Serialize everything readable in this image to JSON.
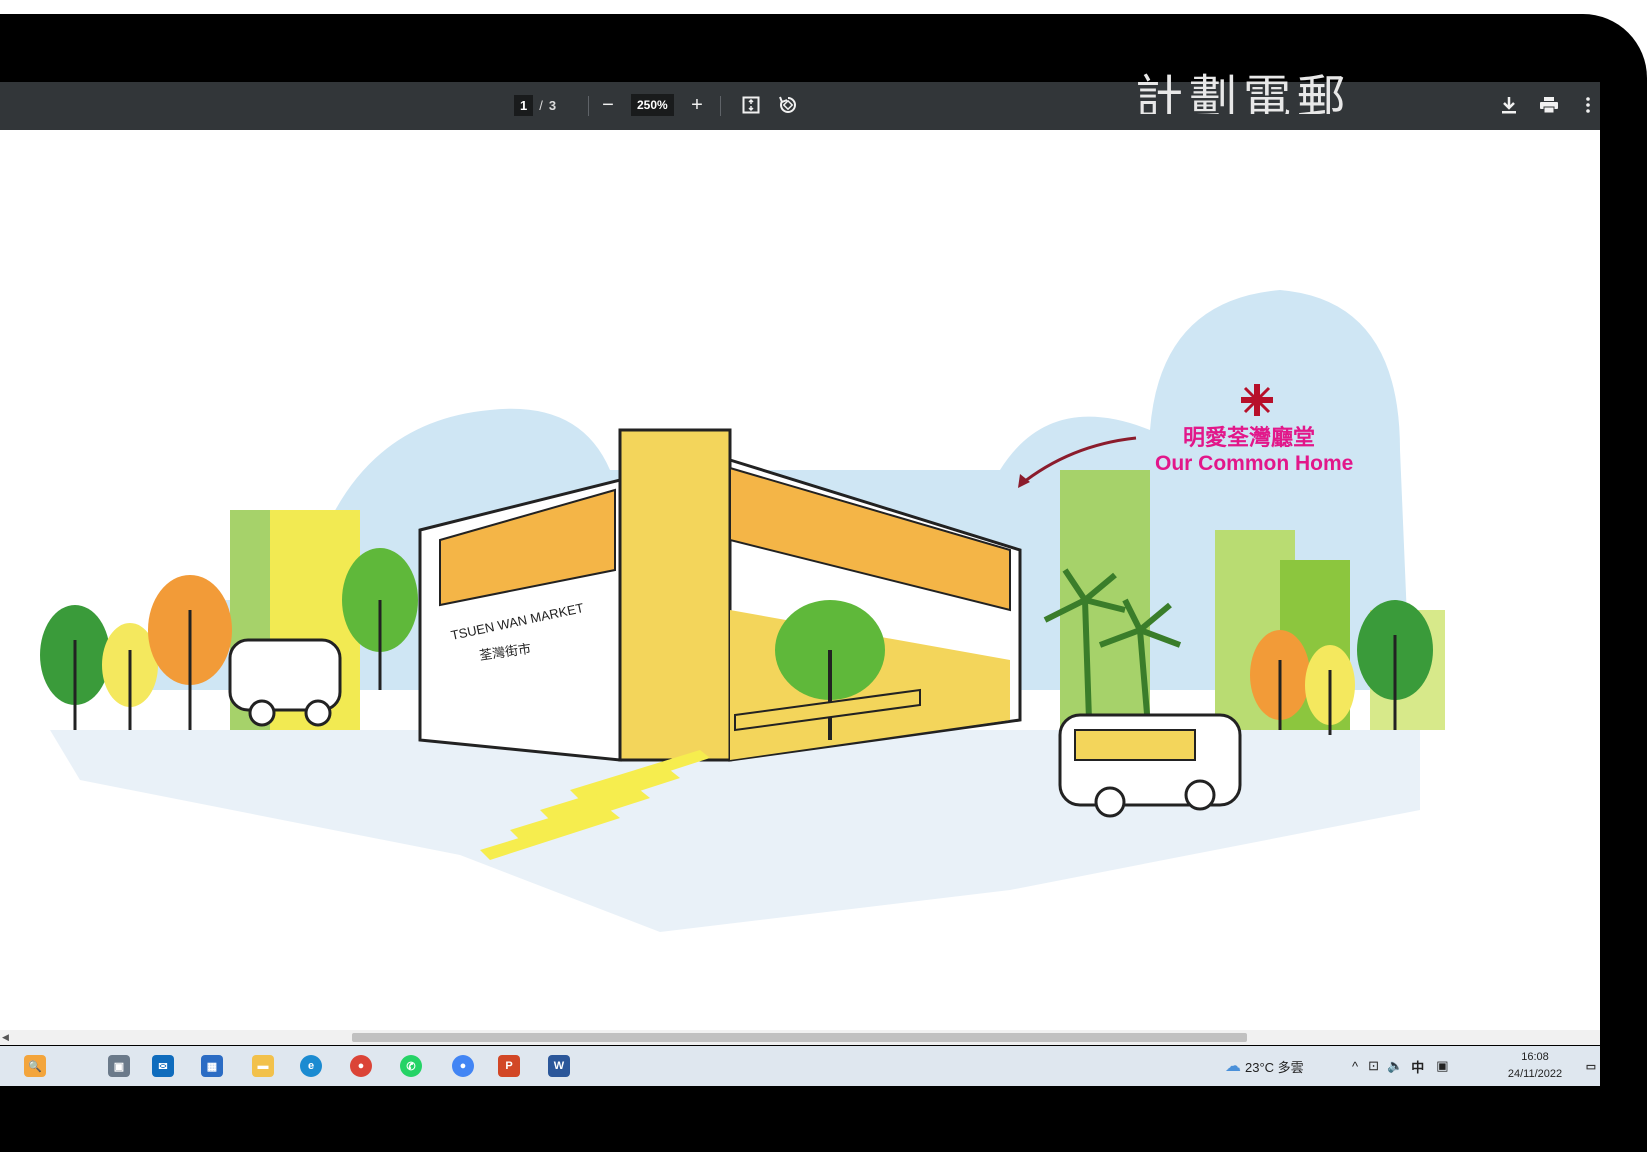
{
  "toolbar": {
    "current_page": "1",
    "page_separator": "/",
    "total_pages": "3",
    "zoom": "250%",
    "zoom_out_label": "−",
    "zoom_in_label": "+",
    "doc_title": "計劃電郵"
  },
  "page": {
    "logo_zh": "明愛荃灣廳堂",
    "logo_en": "Our Common Home",
    "market_sign_en": "TSUEN WAN MARKET",
    "market_sign_zh": "荃灣街市"
  },
  "taskbar": {
    "icons": [
      "search-icon",
      "task-view-icon",
      "mail-icon",
      "store-icon",
      "file-explorer-icon",
      "edge-icon",
      "chrome-icon",
      "whatsapp-icon",
      "chrome-profile-icon",
      "powerpoint-icon",
      "word-icon"
    ],
    "weather": "23°C 多雲",
    "ime": "中",
    "time": "16:08",
    "date": "24/11/2022"
  },
  "colors": {
    "toolbar_bg": "#323639",
    "taskbar_bg": "#dfe7ef",
    "brand_pink": "#e2178a",
    "sky_blue": "#cfe6f4",
    "building_yellow": "#f3d55b",
    "tree_green": "#6fbf3a"
  }
}
